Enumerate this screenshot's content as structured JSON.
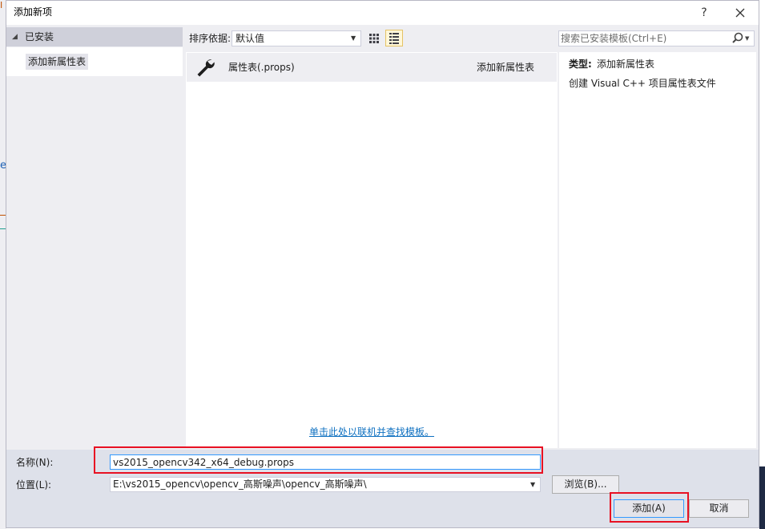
{
  "background": {
    "glyph_top": "I",
    "glyph_mid": "e"
  },
  "dialog": {
    "title": "添加新项",
    "help_label": "?",
    "close_label": "✕"
  },
  "tree": {
    "section_label": "已安装",
    "items": [
      {
        "label": "添加新属性表",
        "selected": true
      }
    ]
  },
  "toolbar": {
    "sort_label": "排序依据:",
    "sort_value": "默认值",
    "search_placeholder": "搜索已安装模板(Ctrl+E)"
  },
  "templates": [
    {
      "icon": "wrench-icon",
      "name": "属性表(.props)",
      "category": "添加新属性表",
      "selected": true
    }
  ],
  "online_link": "单击此处以联机并查找模板。",
  "info": {
    "type_key": "类型:",
    "type_value": "添加新属性表",
    "description": "创建 Visual C++ 项目属性表文件"
  },
  "form": {
    "name_label": "名称(N):",
    "name_value": "vs2015_opencv342_x64_debug.props",
    "location_label": "位置(L):",
    "location_value": "E:\\vs2015_opencv\\opencv_高斯噪声\\opencv_高斯噪声\\",
    "browse_label": "浏览(B)...",
    "add_label": "添加(A)",
    "cancel_label": "取消"
  },
  "colors": {
    "highlight": "#e81123",
    "focus": "#3399ff",
    "link": "#0e70c0",
    "panel": "#eeeef2",
    "bottom": "#dee1ea"
  }
}
